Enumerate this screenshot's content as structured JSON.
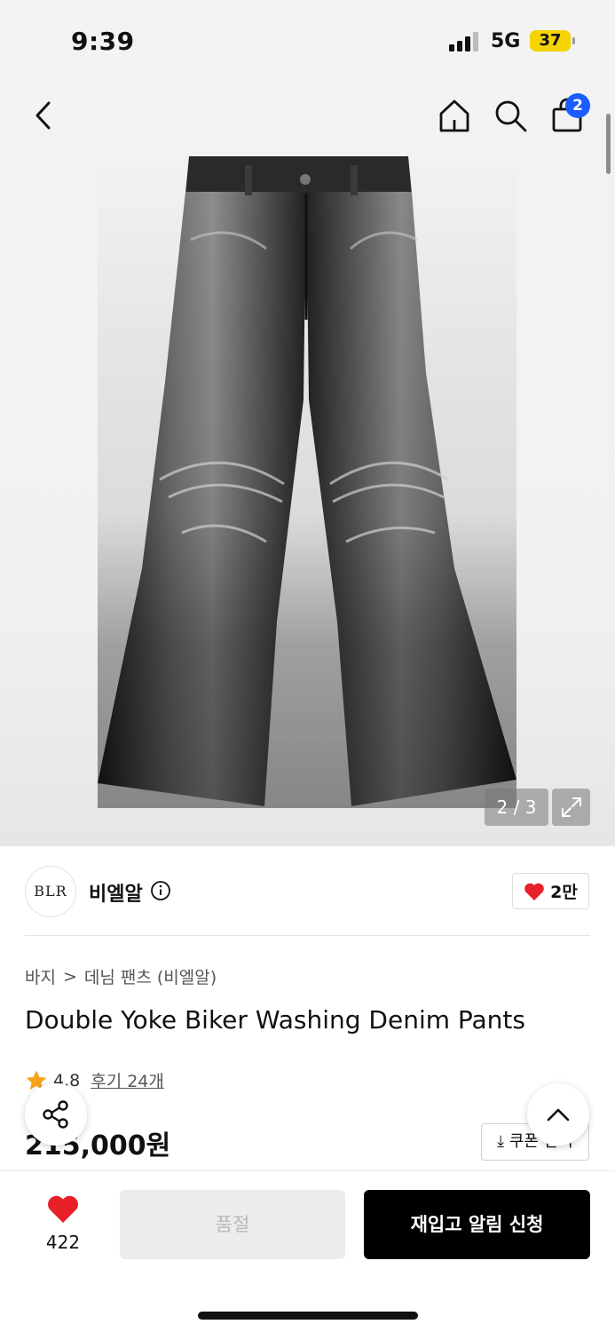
{
  "status_bar": {
    "time": "9:39",
    "network": "5G",
    "battery": "37"
  },
  "nav": {
    "back_icon": "chevron-left-icon",
    "home_icon": "home-icon",
    "search_icon": "search-icon",
    "cart_icon": "bag-icon",
    "cart_count": "2"
  },
  "gallery": {
    "counter": "2 / 3",
    "expand_icon": "expand-icon",
    "image": "black-washed-denim-flare-jeans"
  },
  "brand": {
    "logo_text": "BLR",
    "name": "비엘알",
    "like_count": "2만"
  },
  "breadcrumb": {
    "category": "바지",
    "separator": ">",
    "subcategory": "데님 팬츠 (비엘알)"
  },
  "product": {
    "title": "Double Yoke Biker Washing Denim Pants",
    "rating": "4.8",
    "reviews": "후기 24개",
    "price": "215,000원"
  },
  "coupon": {
    "label": "쿠폰 받기"
  },
  "bottom_bar": {
    "wish_count": "422",
    "soldout_label": "품절",
    "restock_label": "재입고 알림 신청"
  },
  "colors": {
    "accent_blue": "#1a5cff",
    "heart_red": "#e8202a",
    "star_orange": "#f7a21a",
    "battery_yellow": "#f5d300"
  }
}
